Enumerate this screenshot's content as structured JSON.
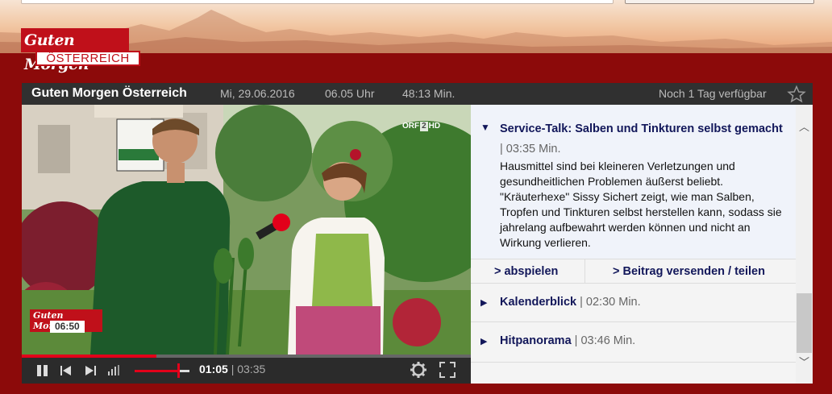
{
  "logo": {
    "line1": "Guten Morgen",
    "line2": "ÖSTERREICH"
  },
  "info_bar": {
    "title": "Guten Morgen Österreich",
    "date": "Mi, 29.06.2016",
    "time": "06.05 Uhr",
    "duration": "48:13 Min.",
    "availability": "Noch 1 Tag verfügbar"
  },
  "video": {
    "channel_badge": [
      "ORF",
      "2",
      "HD"
    ],
    "overlay_title": "Guten Morgen",
    "overlay_clock": "06:50"
  },
  "controls": {
    "current_time": "01:05",
    "separator": "|",
    "total_time": "03:35",
    "progress": 0.3,
    "volume": 0.8
  },
  "playlist": {
    "active": {
      "title": "Service-Talk: Salben und Tinkturen selbst gemacht",
      "duration": "| 03:35 Min.",
      "description": "Hausmittel sind bei kleineren Verletzungen und gesundheitlichen Problemen äußerst beliebt. \"Kräuterhexe\" Sissy Sichert zeigt, wie man Salben, Tropfen und Tinkturen selbst herstellen kann, sodass sie jahrelang aufbewahrt werden können und nicht an Wirkung verlieren.",
      "play_label": "> abspielen",
      "share_label": "> Beitrag versenden / teilen"
    },
    "items": [
      {
        "title": "Kalenderblick",
        "duration": "| 02:30 Min."
      },
      {
        "title": "Hitpanorama",
        "duration": "| 03:46 Min."
      }
    ]
  },
  "colors": {
    "brand_red": "#c0101a",
    "accent_red": "#e2001a",
    "link_navy": "#12175a",
    "page_bg": "#8c0a0a"
  }
}
